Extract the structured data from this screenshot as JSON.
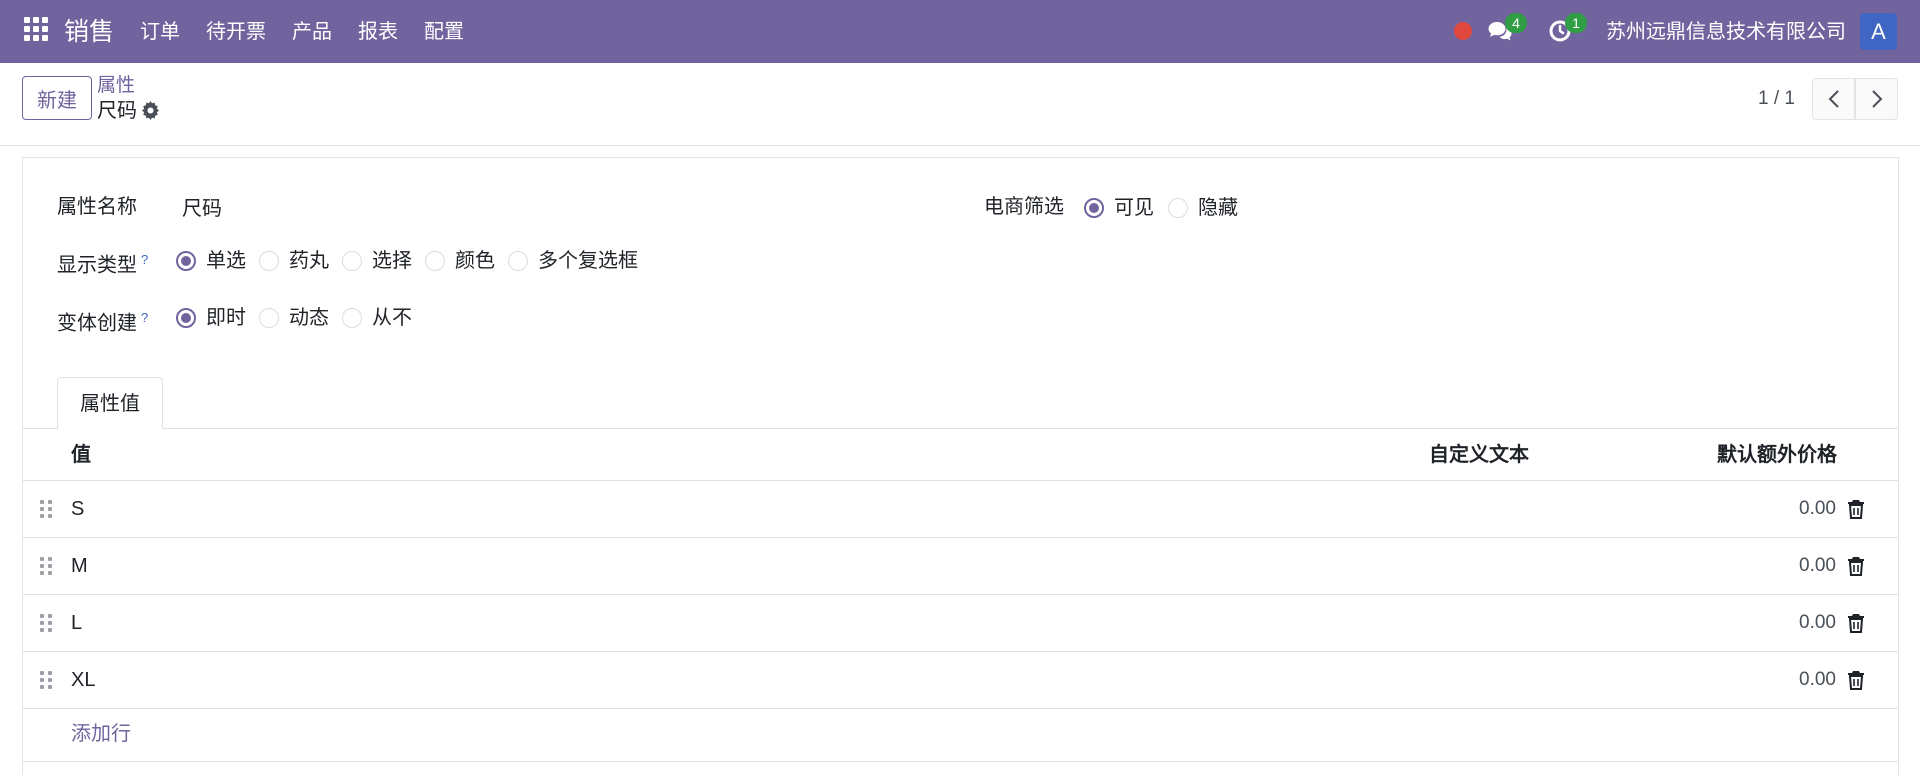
{
  "navbar": {
    "app_name": "销售",
    "menu": [
      "订单",
      "待开票",
      "产品",
      "报表",
      "配置"
    ],
    "chat_count": "4",
    "activity_count": "1",
    "company": "苏州远鼎信息技术有限公司",
    "avatar_letter": "A",
    "colors": {
      "bar": "#71639e",
      "badge": "#2f9e44",
      "record_dot": "#e0483e",
      "avatar": "#3f66c2"
    }
  },
  "control_panel": {
    "new_label": "新建",
    "breadcrumb_parent": "属性",
    "breadcrumb_current": "尺码",
    "pager": "1 / 1"
  },
  "form": {
    "attribute_name_label": "属性名称",
    "attribute_name_value": "尺码",
    "ecommerce_filter_label": "电商筛选",
    "ecommerce_filter_options": [
      {
        "label": "可见",
        "checked": true
      },
      {
        "label": "隐藏",
        "checked": false
      }
    ],
    "display_type_label": "显示类型",
    "display_type_help": "?",
    "display_type_options": [
      {
        "label": "单选",
        "checked": true
      },
      {
        "label": "药丸",
        "checked": false
      },
      {
        "label": "选择",
        "checked": false
      },
      {
        "label": "颜色",
        "checked": false
      },
      {
        "label": "多个复选框",
        "checked": false
      }
    ],
    "variant_creation_label": "变体创建",
    "variant_creation_help": "?",
    "variant_creation_options": [
      {
        "label": "即时",
        "checked": true
      },
      {
        "label": "动态",
        "checked": false
      },
      {
        "label": "从不",
        "checked": false
      }
    ]
  },
  "tabs": {
    "values_tab": "属性值"
  },
  "table": {
    "headers": {
      "value": "值",
      "custom_text": "自定义文本",
      "default_extra_price": "默认额外价格"
    },
    "rows": [
      {
        "name": "S",
        "price": "0.00"
      },
      {
        "name": "M",
        "price": "0.00"
      },
      {
        "name": "L",
        "price": "0.00"
      },
      {
        "name": "XL",
        "price": "0.00"
      }
    ],
    "add_line": "添加行"
  }
}
